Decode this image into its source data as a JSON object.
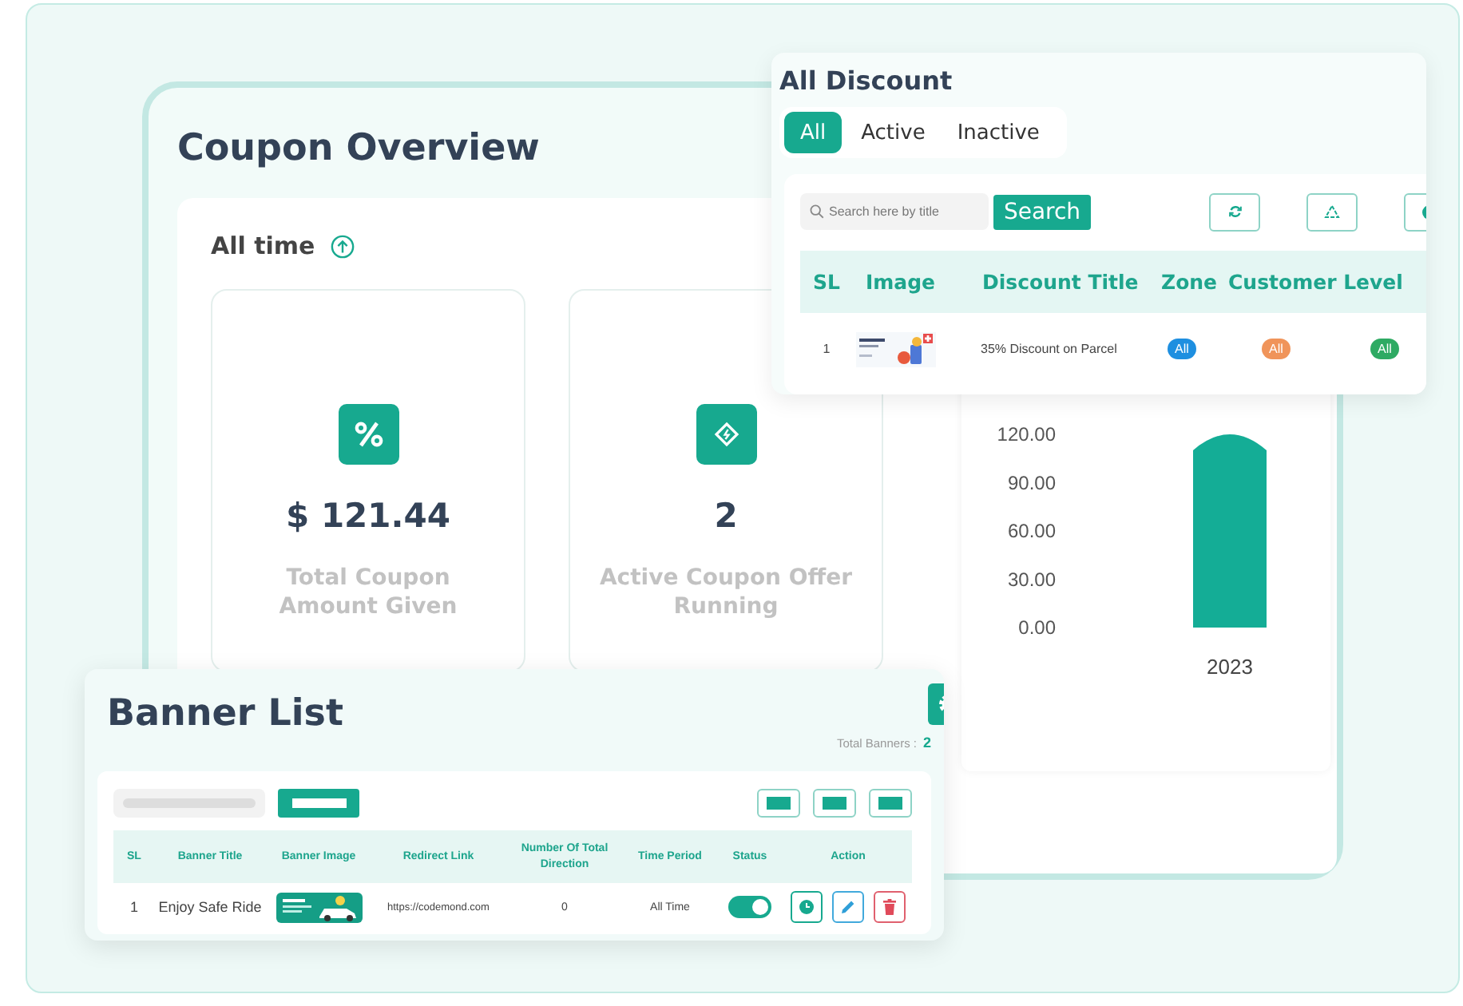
{
  "coupon_overview": {
    "title": "Coupon Overview",
    "period": "All time",
    "stats": [
      {
        "kind": "percent",
        "value": "$ 121.44",
        "label": "Total Coupon Amount Given"
      },
      {
        "kind": "ticket",
        "value": "2",
        "label": "Active Coupon Offer Running"
      }
    ],
    "chart": {
      "chart_data": {
        "type": "bar",
        "categories": [
          "2023"
        ],
        "values": [
          120
        ],
        "ylim": [
          0,
          120
        ],
        "yticks": [
          {
            "value": 0,
            "label": "0.00"
          },
          {
            "value": 30,
            "label": "30.00"
          },
          {
            "value": 60,
            "label": "60.00"
          },
          {
            "value": 90,
            "label": "90.00"
          },
          {
            "value": 120,
            "label": "120.00"
          }
        ]
      }
    }
  },
  "all_discount": {
    "title": "All Discount",
    "tabs": [
      {
        "label": "All",
        "selected": true
      },
      {
        "label": "Active",
        "selected": false
      },
      {
        "label": "Inactive",
        "selected": false
      }
    ],
    "search": {
      "placeholder": "Search here by title",
      "button": "Search"
    },
    "tools": [
      {
        "kind": "refresh"
      },
      {
        "kind": "recycle"
      },
      {
        "kind": "clock"
      }
    ],
    "columns": [
      "SL",
      "Image",
      "Discount Title",
      "Zone",
      "Customer Level"
    ],
    "rows": [
      {
        "sl": "1",
        "title": "35% Discount on Parcel",
        "badges": [
          {
            "label": "All",
            "color": "#1e8fe0"
          },
          {
            "label": "All",
            "color": "#f0945a"
          },
          {
            "label": "All",
            "color": "#2eaa63"
          }
        ]
      }
    ]
  },
  "banner_list": {
    "title": "Banner List",
    "total_label": "Total Banners :",
    "total": "2",
    "tools": [
      {
        "kind": "block"
      },
      {
        "kind": "block"
      },
      {
        "kind": "block"
      }
    ],
    "columns": [
      "SL",
      "Banner Title",
      "Banner Image",
      "Redirect Link",
      "Number Of Total Direction",
      "Time Period",
      "Status",
      "Action"
    ],
    "rows": [
      {
        "sl": "1",
        "title": "Enjoy Safe Ride",
        "link": "https://codemond.com",
        "directions": "0",
        "period": "All Time",
        "on": true,
        "actions": [
          {
            "kind": "clock"
          },
          {
            "kind": "edit"
          },
          {
            "kind": "delete"
          }
        ]
      }
    ]
  }
}
